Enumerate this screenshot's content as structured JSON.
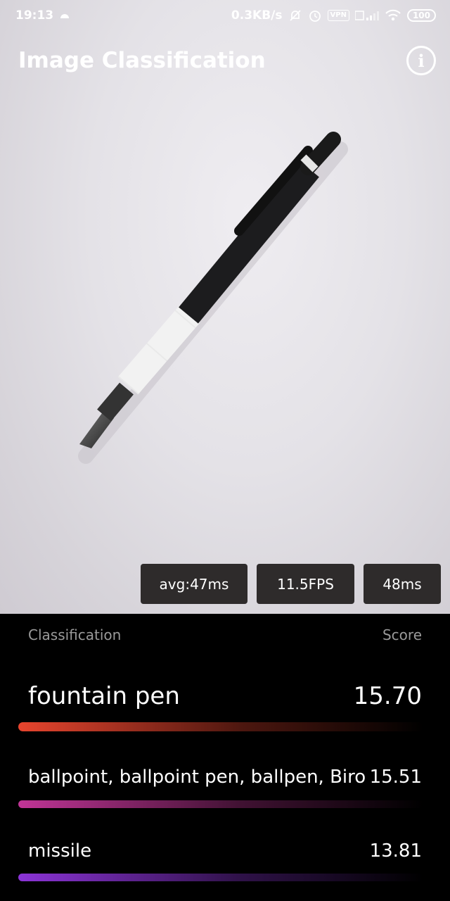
{
  "status_bar": {
    "time": "19:13",
    "net_speed": "0.3KB/s",
    "vpn": "VPN",
    "battery": "100",
    "icons": [
      "app-notification-icon",
      "mute-icon",
      "alarm-icon",
      "vpn-icon",
      "signal-icon",
      "wifi-icon",
      "battery-icon"
    ]
  },
  "app_bar": {
    "title": "Image Classification",
    "info_icon": "i"
  },
  "stats": {
    "avg": "avg:47ms",
    "fps": "11.5FPS",
    "latency": "48ms"
  },
  "results": {
    "header_label": "Classification",
    "header_score": "Score",
    "items": [
      {
        "label": "fountain pen",
        "score": "15.70",
        "color": "#e8452e"
      },
      {
        "label": "ballpoint, ballpoint pen, ballpen, Biro",
        "score": "15.51",
        "color": "#c13597"
      },
      {
        "label": "missile",
        "score": "13.81",
        "color": "#8c34d8"
      }
    ]
  }
}
